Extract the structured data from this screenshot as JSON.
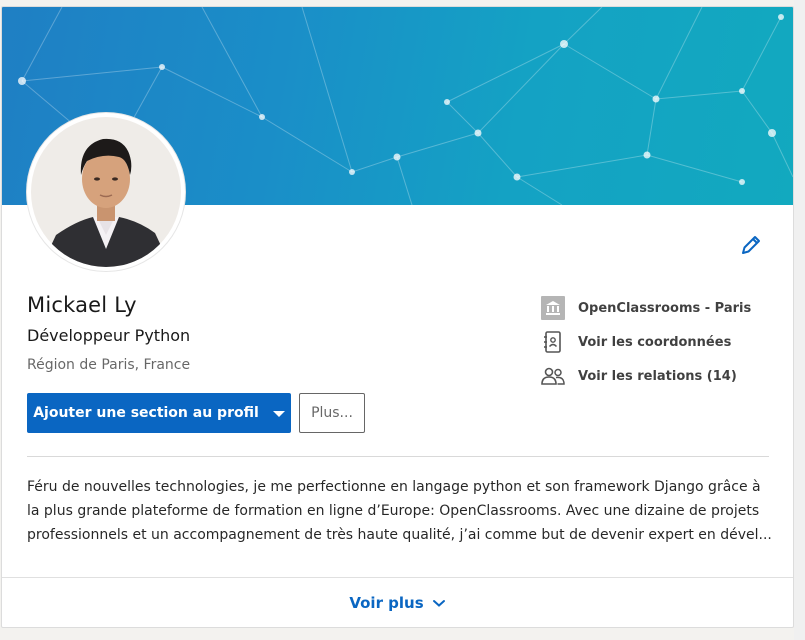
{
  "profile": {
    "name": "Mickael Ly",
    "headline": "Développeur Python",
    "location": "Région de Paris, France"
  },
  "actions": {
    "add_section_label": "Ajouter une section au profil",
    "more_label": "Plus..."
  },
  "side_links": {
    "school": {
      "label": "OpenClassrooms - Paris",
      "icon": "school-building-icon"
    },
    "contact": {
      "label": "Voir les coordonnées",
      "icon": "address-book-icon"
    },
    "connections": {
      "label": "Voir les relations (14)",
      "icon": "people-icon"
    }
  },
  "summary": {
    "lines": [
      "Féru de nouvelles technologies, je me perfectionne en langage python et son framework Django grâce à",
      "la plus grande plateforme de formation en ligne d’Europe: OpenClassrooms. Avec une dizaine de projets",
      "professionnels et un accompagnement de très haute qualité, j’ai comme but de devenir expert en dével..."
    ]
  },
  "footer": {
    "show_more_label": "Voir plus"
  },
  "colors": {
    "primary": "#0a66c2",
    "banner_start": "#1f7fc4",
    "banner_end": "#12a9bf"
  }
}
